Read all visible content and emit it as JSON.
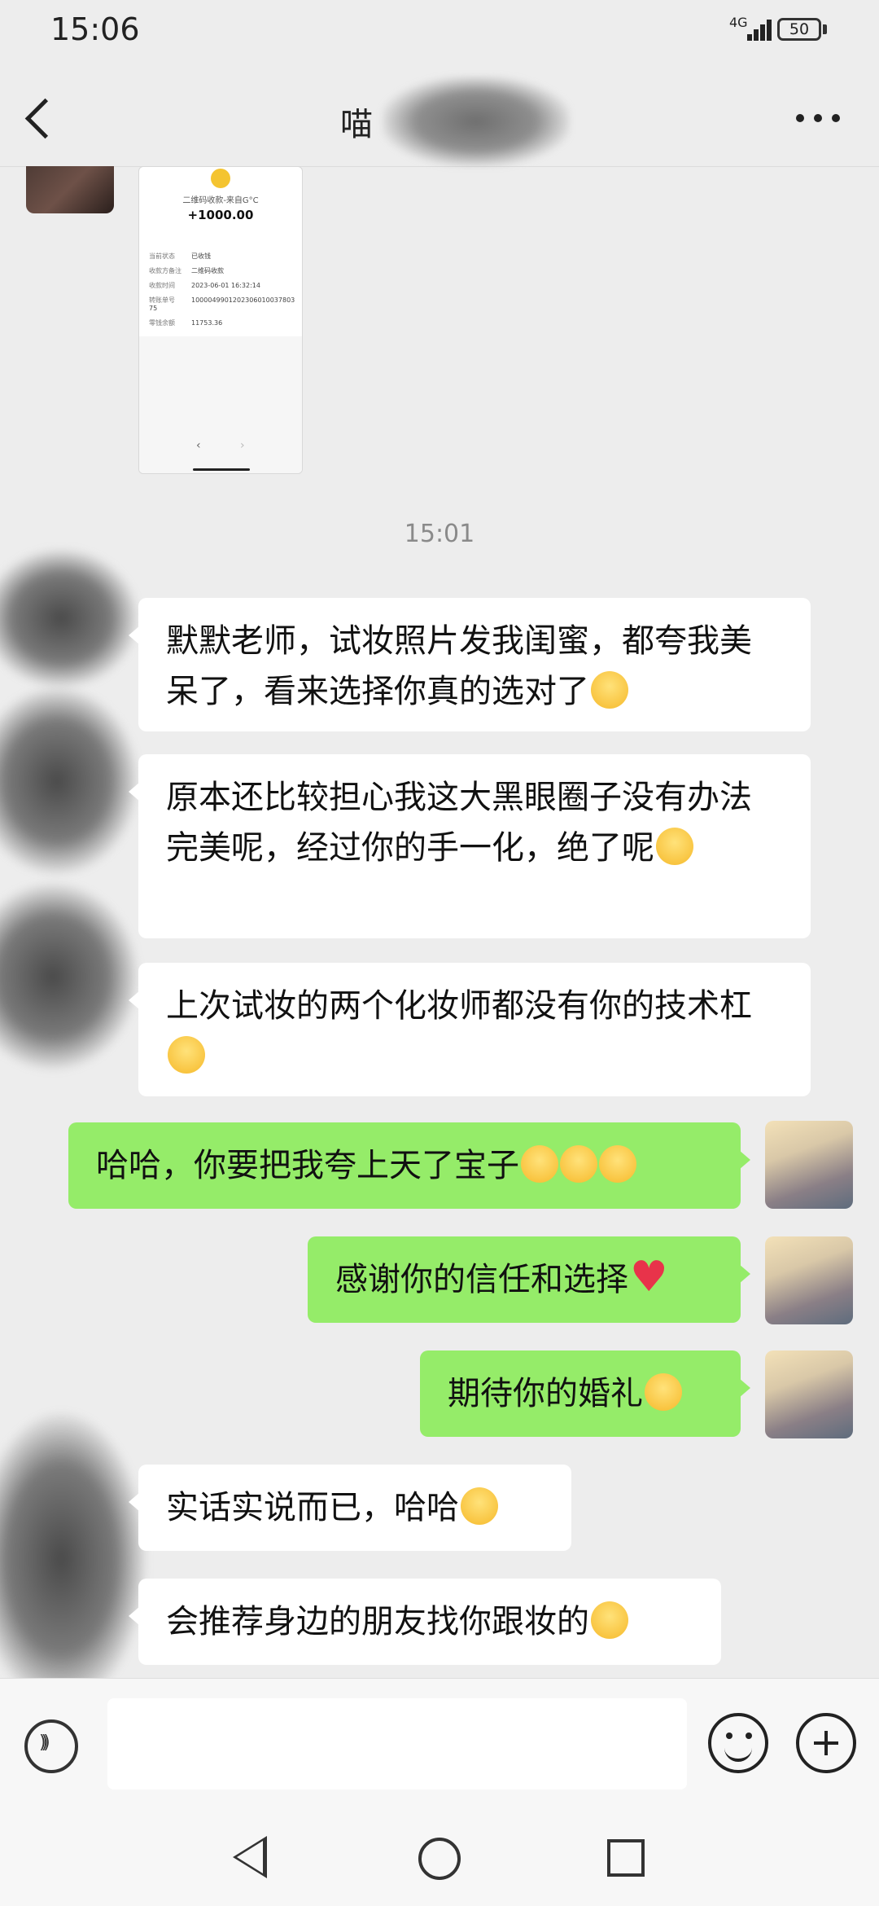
{
  "status_bar": {
    "time": "15:06",
    "network": "4G",
    "battery": "50"
  },
  "header": {
    "title": "喵"
  },
  "receipt": {
    "subtitle": "二维码收款-来自G°C",
    "amount": "+1000.00",
    "rows": [
      {
        "key": "当前状态",
        "value": "已收钱"
      },
      {
        "key": "收款方备注",
        "value": "二维码收款"
      },
      {
        "key": "收款时间",
        "value": "2023-06-01 16:32:14"
      },
      {
        "key": "转账单号",
        "value": "1000049901202306010037803 75"
      },
      {
        "key": "零钱余额",
        "value": "11753.36"
      }
    ]
  },
  "timestamp": "15:01",
  "messages": [
    {
      "text": "默默老师，试妆照片发我闺蜜，都夸我美呆了，看来选择你真的选对了"
    },
    {
      "text": "原本还比较担心我这大黑眼圈子没有办法完美呢，经过你的手一化，绝了呢"
    },
    {
      "text": "上次试妆的两个化妆师都没有你的技术杠"
    },
    {
      "text": "哈哈，你要把我夸上天了宝子"
    },
    {
      "text": "感谢你的信任和选择"
    },
    {
      "text": "期待你的婚礼"
    },
    {
      "text": "实话实说而已，哈哈"
    },
    {
      "text": "会推荐身边的朋友找你跟妆的"
    }
  ],
  "colors": {
    "background": "#ededed",
    "outgoing_bubble": "#95ec69",
    "incoming_bubble": "#ffffff"
  }
}
